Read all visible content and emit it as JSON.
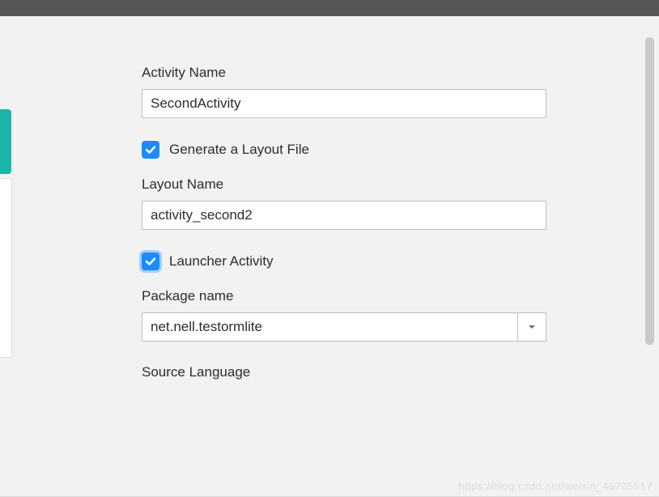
{
  "form": {
    "activity_name_label": "Activity Name",
    "activity_name_value": "SecondActivity",
    "generate_layout_checked": true,
    "generate_layout_label": "Generate a Layout File",
    "layout_name_label": "Layout Name",
    "layout_name_value": "activity_second2",
    "launcher_activity_checked": true,
    "launcher_activity_label": "Launcher Activity",
    "package_name_label": "Package name",
    "package_name_value": "net.nell.testormlite",
    "source_language_label": "Source Language"
  },
  "colors": {
    "accent_teal": "#1bb5a8",
    "accent_blue": "#1a8cff",
    "panel_bg": "#f2f2f2",
    "titlebar": "#555658"
  },
  "watermark": "https://blog.csdn.net/weixin_46705517"
}
